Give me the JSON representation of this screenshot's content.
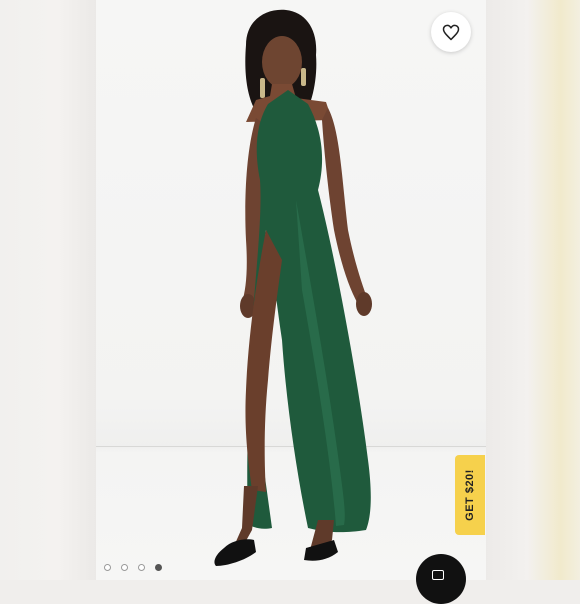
{
  "listing": {
    "promo_label": "GET $20!",
    "carousel": {
      "total": 4,
      "active_index": 3
    }
  },
  "icons": {
    "like": "heart-icon",
    "corner_button": "camera-icon"
  },
  "colors": {
    "dress": "#1f5a3c",
    "promo_bg": "#f6d14c",
    "dot_active": "#555555"
  }
}
